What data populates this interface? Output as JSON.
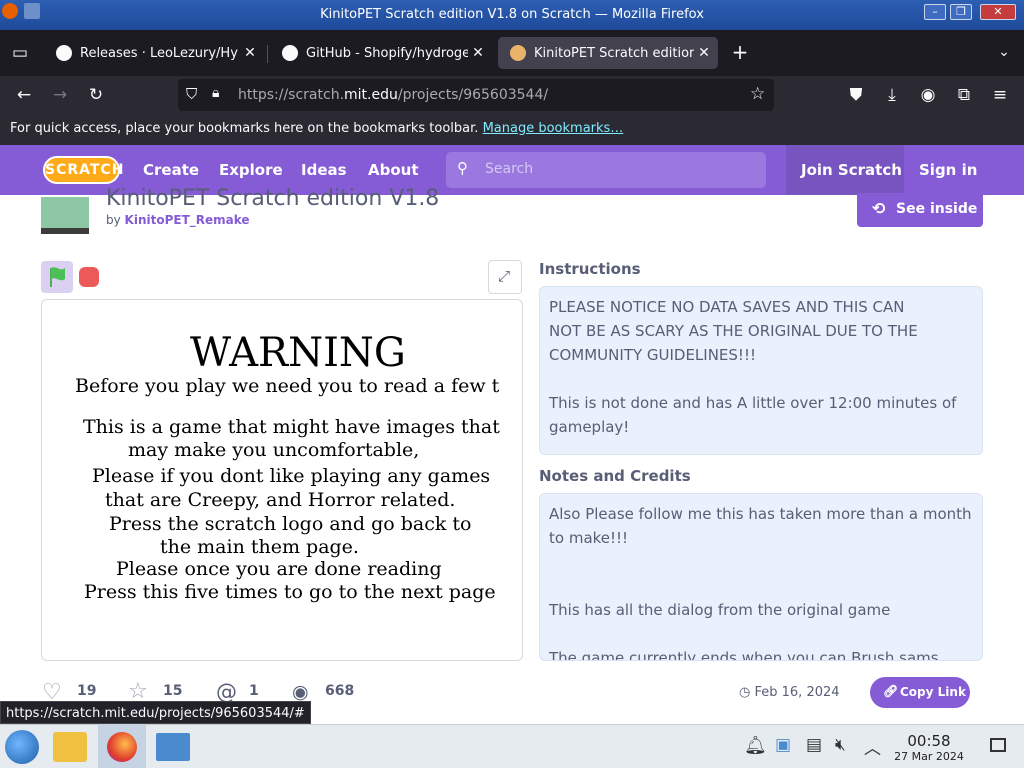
{
  "window": {
    "title": "KinitoPET Scratch edition V1.8 on Scratch — Mozilla Firefox"
  },
  "tabs": [
    {
      "label": "Releases · LeoLezury/Hy",
      "active": false
    },
    {
      "label": "GitHub - Shopify/hydroge",
      "active": false
    },
    {
      "label": "KinitoPET Scratch editior",
      "active": true
    }
  ],
  "address": {
    "prefix": "https://scratch.",
    "domain": "mit.edu",
    "path": "/projects/965603544/"
  },
  "bookmarks_bar": {
    "text": "For quick access, place your bookmarks here on the bookmarks toolbar.",
    "link": "Manage bookmarks…"
  },
  "scratch_nav": {
    "logo": "SCRATCH",
    "items": [
      "Create",
      "Explore",
      "Ideas",
      "About"
    ],
    "search_placeholder": "Search",
    "join": "Join Scratch",
    "signin": "Sign in"
  },
  "project": {
    "title": "KinitoPET Scratch edition V1.8",
    "by": "by",
    "author": "KinitoPET_Remake",
    "see_inside": "See inside"
  },
  "stage_text": {
    "warning": "WARNING",
    "lines": [
      "Before you play we need you to read a few t",
      "This is a game that might have images that",
      "may make you uncomfortable,",
      "Please if you dont like playing any games",
      "that are Creepy, and Horror related.",
      "Press the scratch logo and go back to",
      "the main them page.",
      "Please once you are done reading",
      "Press this five times to go to the next page"
    ]
  },
  "instructions": {
    "heading": "Instructions",
    "lines": [
      "PLEASE NOTICE NO DATA SAVES AND THIS CAN",
      "NOT BE AS SCARY AS THE ORIGINAL DUE TO THE",
      "COMMUNITY GUIDELINES!!!",
      "This is not done and has A little over 12:00 minutes of",
      "gameplay!"
    ]
  },
  "notes": {
    "heading": "Notes and Credits",
    "lines": [
      "Also Please follow me this has taken more than a month",
      "to make!!!",
      "This has all the dialog from the original game",
      "The game currently ends when you can Brush sams house"
    ]
  },
  "stats": {
    "loves": "19",
    "favorites": "15",
    "remixes": "1",
    "views": "668",
    "date": "Feb 16, 2024",
    "copy_link": "Copy Link"
  },
  "status_url": "https://scratch.mit.edu/projects/965603544/#",
  "taskbar": {
    "time": "00:58",
    "date": "27 Mar 2024"
  }
}
